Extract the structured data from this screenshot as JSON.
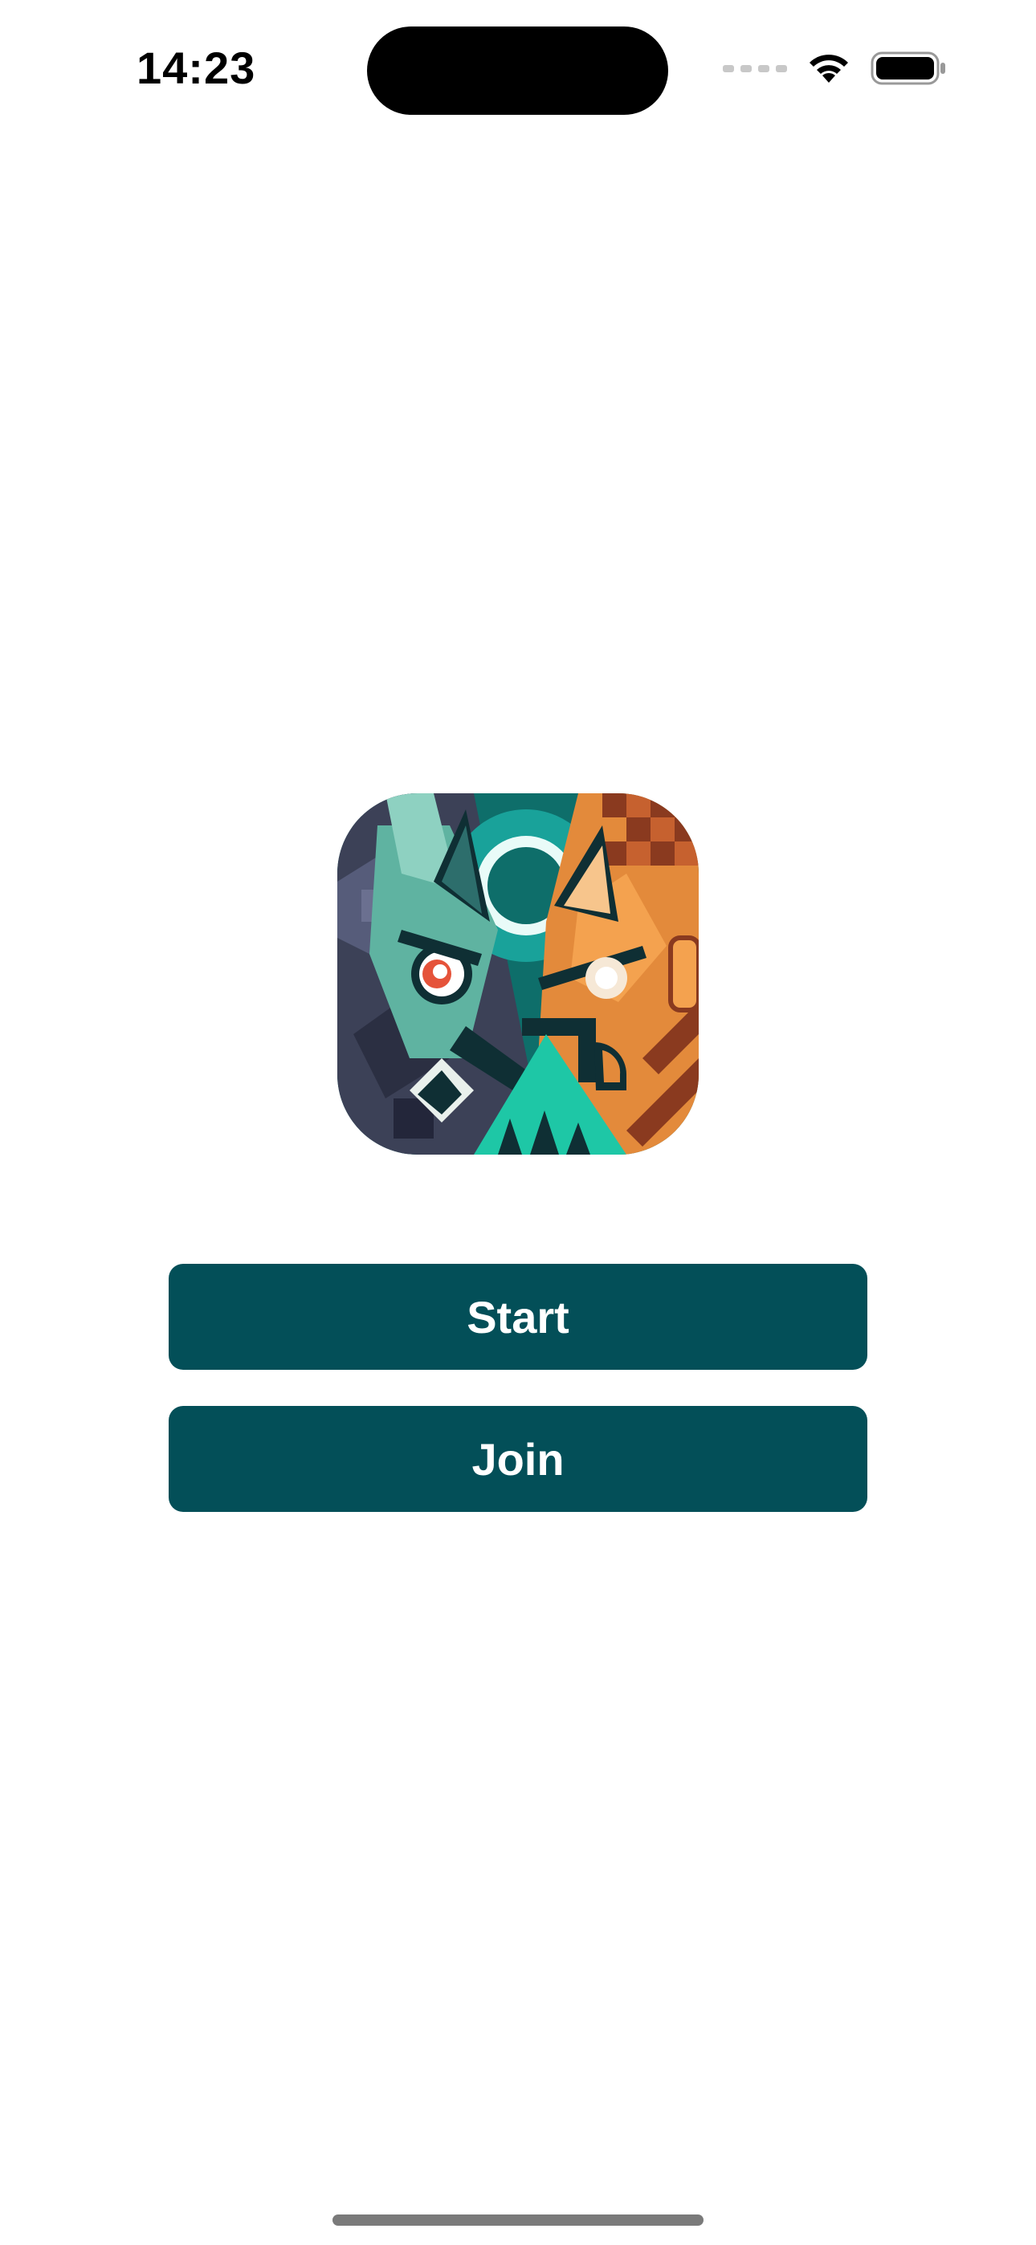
{
  "status_bar": {
    "time": "14:23",
    "icons": [
      "signal-icon",
      "wifi-icon",
      "battery-icon"
    ]
  },
  "app": {
    "logo_icon": "game-logo-icon",
    "accent_color": "#034f58"
  },
  "buttons": {
    "start_label": "Start",
    "join_label": "Join"
  }
}
